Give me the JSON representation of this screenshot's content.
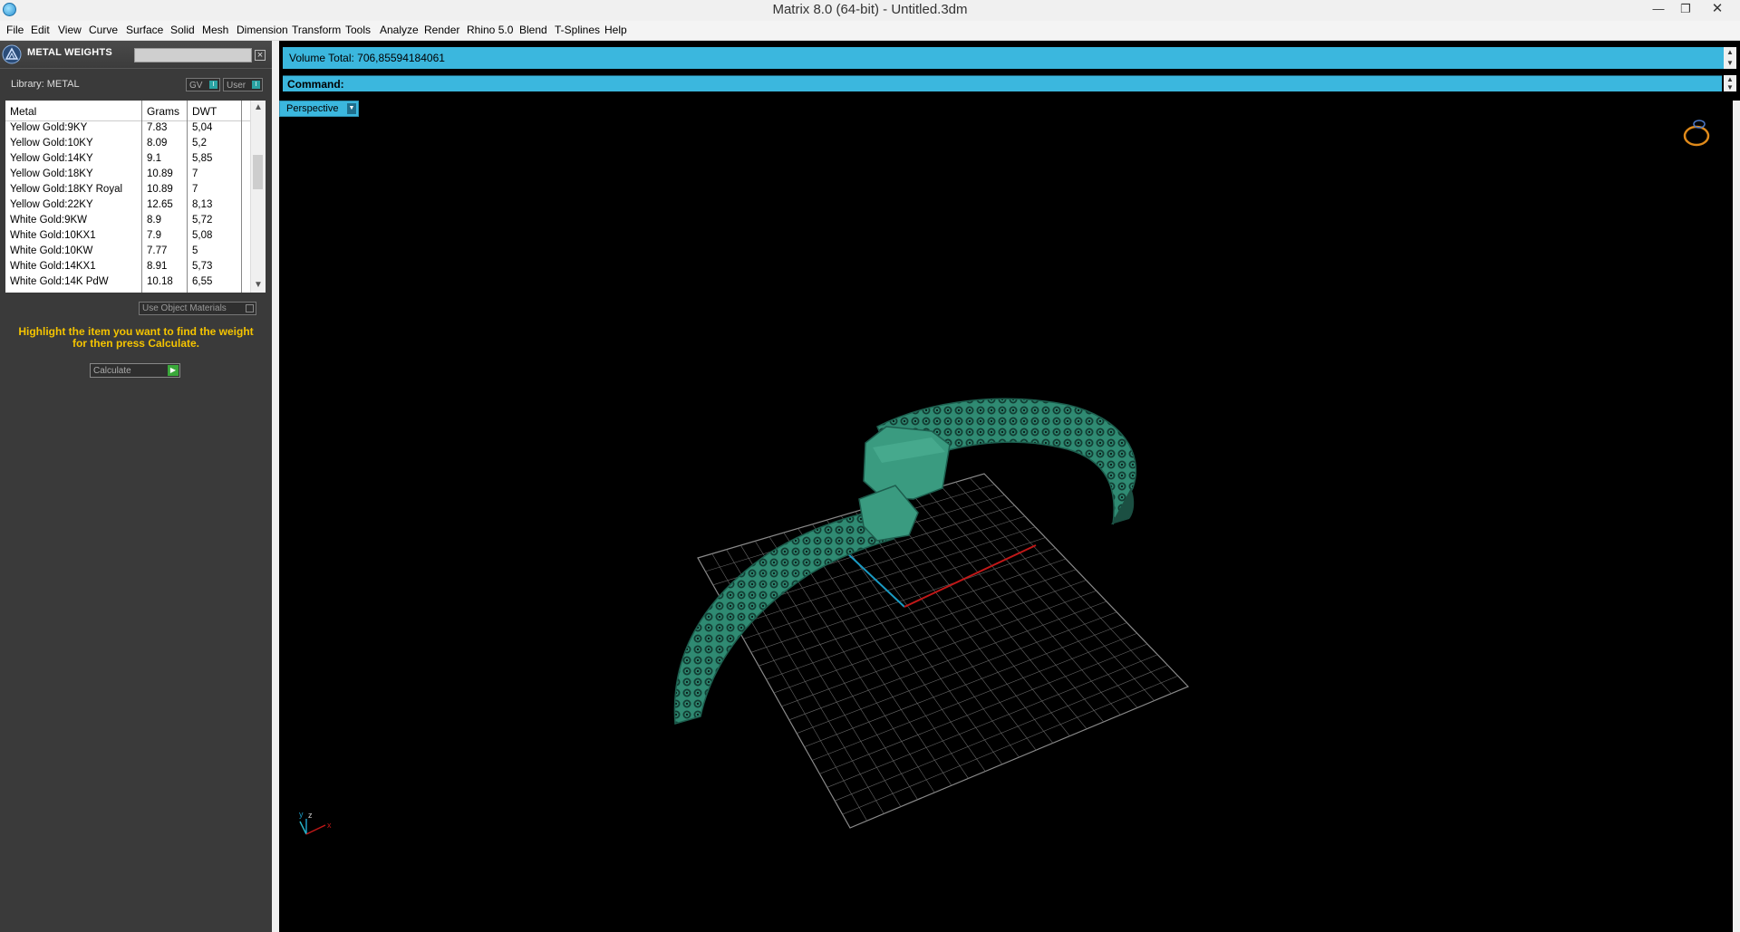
{
  "window": {
    "title": "Matrix 8.0 (64-bit) - Untitled.3dm",
    "controls": [
      "minimize-icon",
      "restore-icon",
      "close-icon"
    ]
  },
  "menu": [
    "File",
    "Edit",
    "View",
    "Curve",
    "Surface",
    "Solid",
    "Mesh",
    "Dimension",
    "Transform",
    "Tools",
    "Analyze",
    "Render",
    "Rhino 5.0",
    "Blend",
    "T-Splines",
    "Help"
  ],
  "panel": {
    "title": "METAL WEIGHTS",
    "library_label": "Library: METAL",
    "gv_label": "GV",
    "user_label": "User",
    "table": {
      "headers": [
        "Metal",
        "Grams",
        "DWT"
      ],
      "rows": [
        [
          "Yellow Gold:9KY",
          "7.83",
          "5,04"
        ],
        [
          "Yellow Gold:10KY",
          "8.09",
          "5,2"
        ],
        [
          "Yellow Gold:14KY",
          "9.1",
          "5,85"
        ],
        [
          "Yellow Gold:18KY",
          "10.89",
          "7"
        ],
        [
          "Yellow Gold:18KY Royal",
          "10.89",
          "7"
        ],
        [
          "Yellow Gold:22KY",
          "12.65",
          "8,13"
        ],
        [
          "White Gold:9KW",
          "8.9",
          "5,72"
        ],
        [
          "White Gold:10KX1",
          "7.9",
          "5,08"
        ],
        [
          "White Gold:10KW",
          "7.77",
          "5"
        ],
        [
          "White Gold:14KX1",
          "8.91",
          "5,73"
        ],
        [
          "White Gold:14K PdW",
          "10.18",
          "6,55"
        ]
      ]
    },
    "use_object_materials": "Use Object Materials",
    "hint": "Highlight the item you want to find the weight for then press Calculate.",
    "calculate": "Calculate"
  },
  "command": {
    "volume_total": "Volume Total: 706,85594184061",
    "command_label": "Command:"
  },
  "viewport": {
    "name": "Perspective",
    "axis_labels": {
      "x": "x",
      "y": "y",
      "z": "z"
    }
  },
  "colors": {
    "accent": "#3bb7de",
    "panel_bg": "#3a3a3a",
    "hint": "#f5c400",
    "model": "#2f8a72",
    "grid": "#8a8a8a",
    "x_axis": "#c01818",
    "y_axis": "#1a9bc4"
  }
}
